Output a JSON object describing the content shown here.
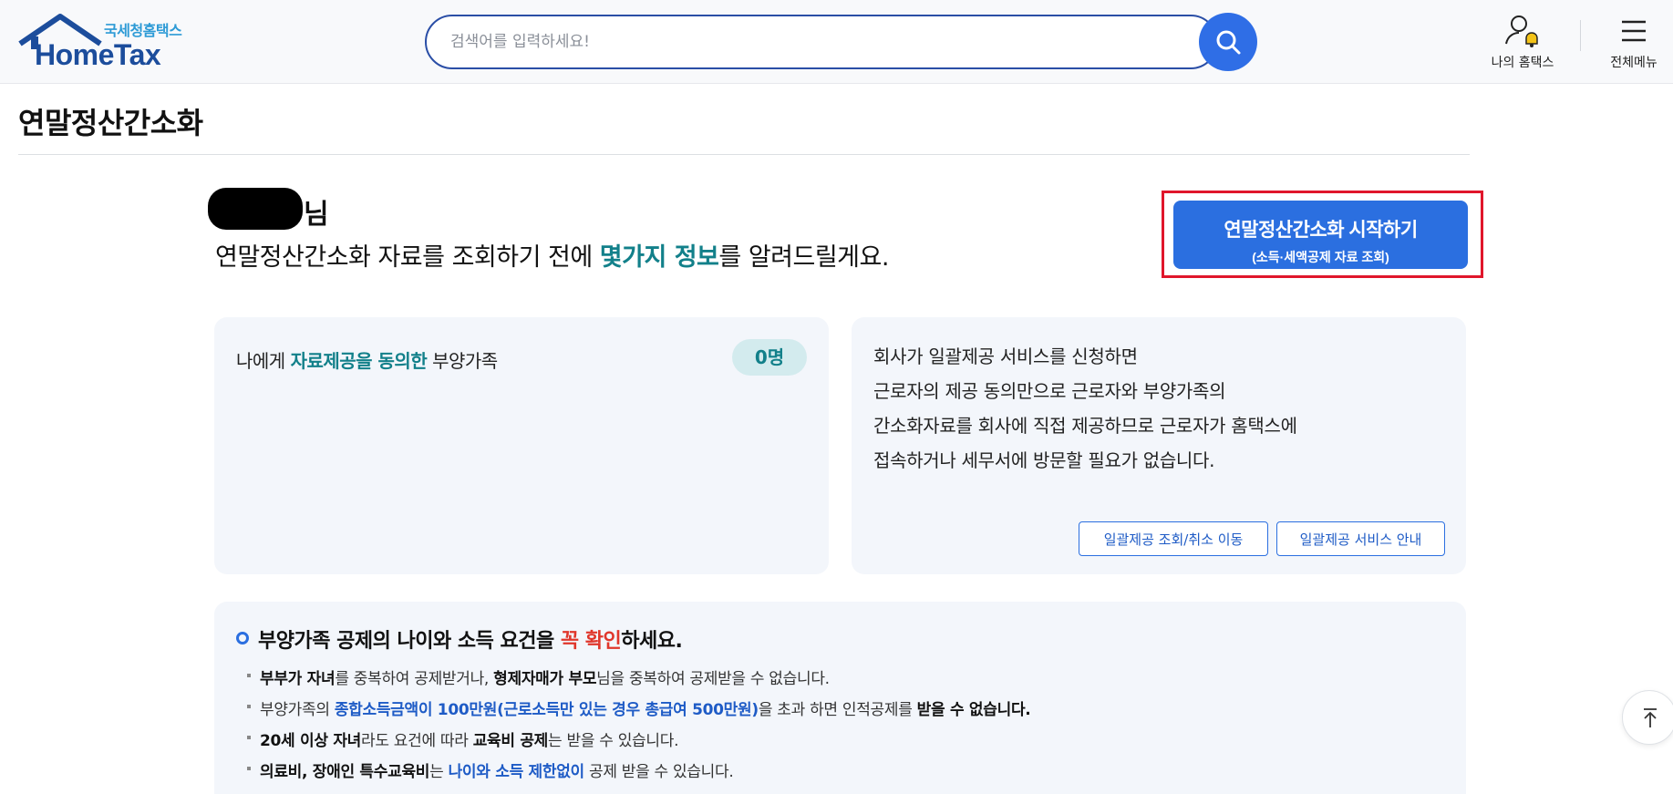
{
  "header": {
    "logo_sub": "국세청홈택스",
    "logo_main": "HomeTax",
    "search_placeholder": "검색어를 입력하세요!",
    "my_hometax": "나의 홈택스",
    "all_menu": "전체메뉴",
    "icons": {
      "search": "search-icon",
      "user": "user-bell-icon",
      "menu": "hamburger-icon"
    }
  },
  "page": {
    "title": "연말정산간소화"
  },
  "greeting": {
    "suffix": "님",
    "intro_pre": "연말정산간소화 자료를 조회하기 전에 ",
    "intro_hl": "몇가지 정보",
    "intro_post": "를 알려드릴게요."
  },
  "start_button": {
    "line1": "연말정산간소화 시작하기",
    "line2": "(소득·세액공제 자료 조회)"
  },
  "consent_card": {
    "label_pre": "나에게 ",
    "label_hl": "자료제공을 동의한",
    "label_post": " 부양가족",
    "count": "0명"
  },
  "bulk_card": {
    "lines": [
      "회사가 일괄제공 서비스를 신청하면",
      "근로자의 제공 동의만으로 근로자와 부양가족의",
      "간소화자료를 회사에 직접 제공하므로 근로자가 홈택스에",
      "접속하거나 세무서에 방문할 필요가 없습니다."
    ],
    "btn_lookup": "일괄제공 조회/취소 이동",
    "btn_guide": "일괄제공 서비스 안내"
  },
  "notice": {
    "head_pre": "부양가족 공제의 나이와 소득 요건을 ",
    "head_red": "꼭 확인",
    "head_post": "하세요.",
    "items": [
      {
        "b1": "부부가 자녀",
        "t1": "를 중복하여 공제받거나, ",
        "b2": "형제자매가 부모",
        "t2": "님을 중복하여 공제받을 수 없습니다."
      },
      {
        "t1": "부양가족의 ",
        "blue": "종합소득금액이 100만원(근로소득만 있는 경우 총급여 500만원)",
        "t2": "을 초과 하면 인적공제를 ",
        "b2": "받을 수 없습니다."
      },
      {
        "b1": "20세 이상 자녀",
        "t1": "라도 요건에 따라 ",
        "b2": "교육비 공제",
        "t2": "는 받을 수 있습니다."
      },
      {
        "b1": "의료비, 장애인 특수교육비",
        "t1": "는 ",
        "blue": "나이와 소득 제한없이",
        "t2": " 공제 받을 수 있습니다."
      }
    ]
  },
  "colors": {
    "accent": "#2b6fe0",
    "teal": "#12808a",
    "red_frame": "#e0162b",
    "navy": "#1c4d9c"
  }
}
